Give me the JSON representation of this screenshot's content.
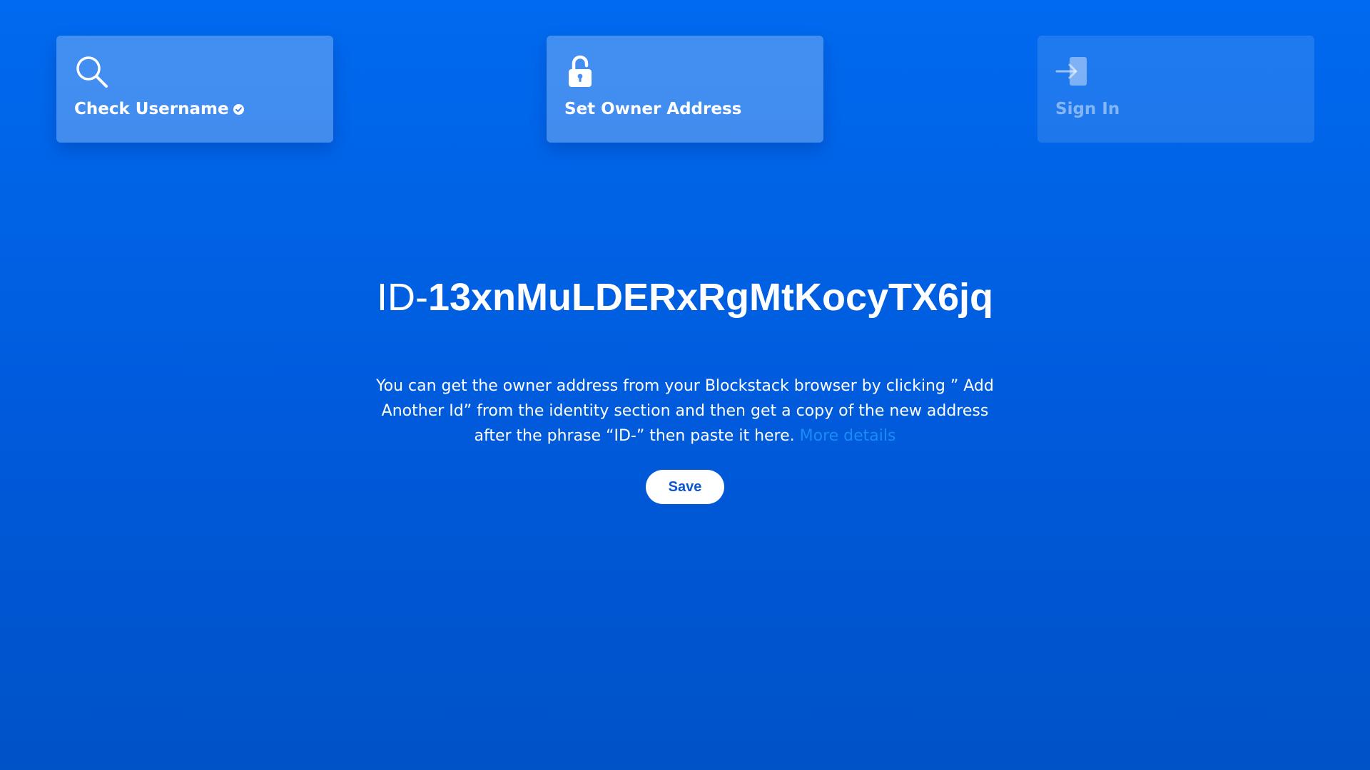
{
  "steps": [
    {
      "label": "Check Username",
      "icon": "search-icon",
      "badge_icon": "check-circle-icon",
      "state": "completed"
    },
    {
      "label": "Set Owner Address",
      "icon": "unlock-icon",
      "state": "active"
    },
    {
      "label": "Sign In",
      "icon": "sign-in-icon",
      "state": "disabled"
    }
  ],
  "main": {
    "id_prefix": "ID-",
    "id_value": "13xnMuLDERxRgMtKocyTX6jq",
    "description": "You can get the owner address from your Blockstack browser by clicking ” Add Another Id” from the identity section and then get a copy of the new address after the phrase “ID-” then paste it here.",
    "more_link": "More details",
    "save_label": "Save"
  },
  "colors": {
    "background_top": "#006af0",
    "background_bottom": "#0052c7",
    "link": "#1a8cf5",
    "save_text": "#0a56cc"
  }
}
